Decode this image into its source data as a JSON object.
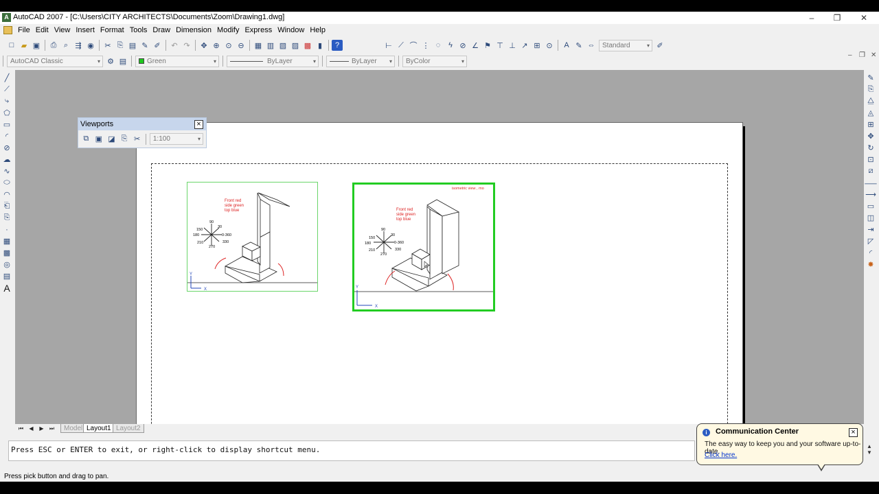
{
  "window": {
    "title": "AutoCAD 2007 - [C:\\Users\\CITY ARCHITECTS\\Documents\\Zoom\\Drawing1.dwg]"
  },
  "menu": [
    "File",
    "Edit",
    "View",
    "Insert",
    "Format",
    "Tools",
    "Draw",
    "Dimension",
    "Modify",
    "Express",
    "Window",
    "Help"
  ],
  "toolbar": {
    "text_style": "Standard",
    "workspace": "AutoCAD Classic",
    "layer": "Green",
    "linetype": "ByLayer",
    "lineweight": "ByLayer",
    "plotstyle": "ByColor"
  },
  "viewports_toolbar": {
    "title": "Viewports",
    "scale": "1:100"
  },
  "drawing": {
    "colors": [
      "Front red",
      "side green",
      "top blue"
    ],
    "compass": [
      "90",
      "30",
      "150",
      "180",
      "0-360",
      "210",
      "330",
      "270"
    ],
    "compass2": [
      "90",
      "30",
      "150",
      "180",
      "0-360",
      "210",
      "330",
      "270"
    ],
    "vp2_label": "isometric view , mo",
    "axis_x": "X",
    "axis_y": "Y"
  },
  "tabs": {
    "model": "Model",
    "layout1": "Layout1",
    "layout2": "Layout2"
  },
  "command_line": "Press ESC or ENTER to exit, or right-click to display shortcut menu.",
  "status": "Press pick button and drag to pan.",
  "comm_center": {
    "title": "Communication Center",
    "message": "The easy way to keep you and your software up-to-date.",
    "link": "Click here."
  }
}
